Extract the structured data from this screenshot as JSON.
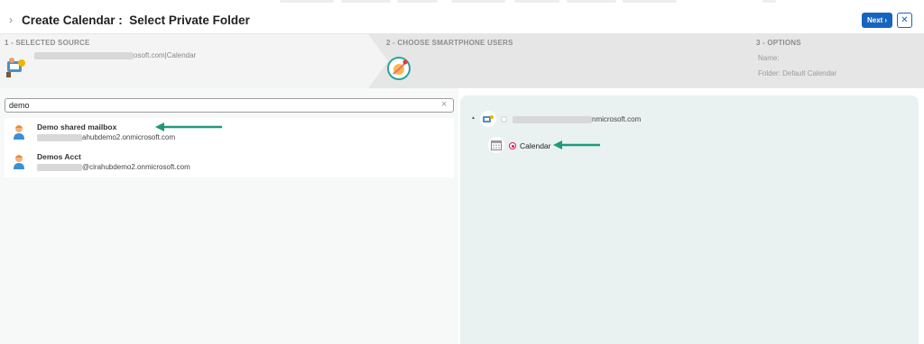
{
  "header": {
    "title": "Create Calendar :  Select Private Folder",
    "next_label": "Next",
    "next_icon": "›",
    "close_icon": "✕",
    "chevron_icon": "›"
  },
  "steps": [
    {
      "title": "1 - SELECTED SOURCE",
      "source_suffix": "osoft.com|Calendar"
    },
    {
      "title": "2 - CHOOSE SMARTPHONE USERS"
    },
    {
      "title": "3 - OPTIONS",
      "name_label": "Name:",
      "folder_label": "Folder: Default Calendar"
    }
  ],
  "search": {
    "value": "demo",
    "clear_icon": "×"
  },
  "results": [
    {
      "name": "Demo shared mailbox",
      "email_suffix": "ahubdemo2.onmicrosoft.com"
    },
    {
      "name": "Demos Acct",
      "email_suffix": "@cirahubdemo2.onmicrosoft.com"
    }
  ],
  "tree": {
    "expand_icon": "▲",
    "account_suffix": "nmicrosoft.com",
    "folder_label": "Calendar"
  },
  "colors": {
    "accent": "#1565c0",
    "radio": "#d81b60",
    "arrow": "#1d9a7a"
  }
}
